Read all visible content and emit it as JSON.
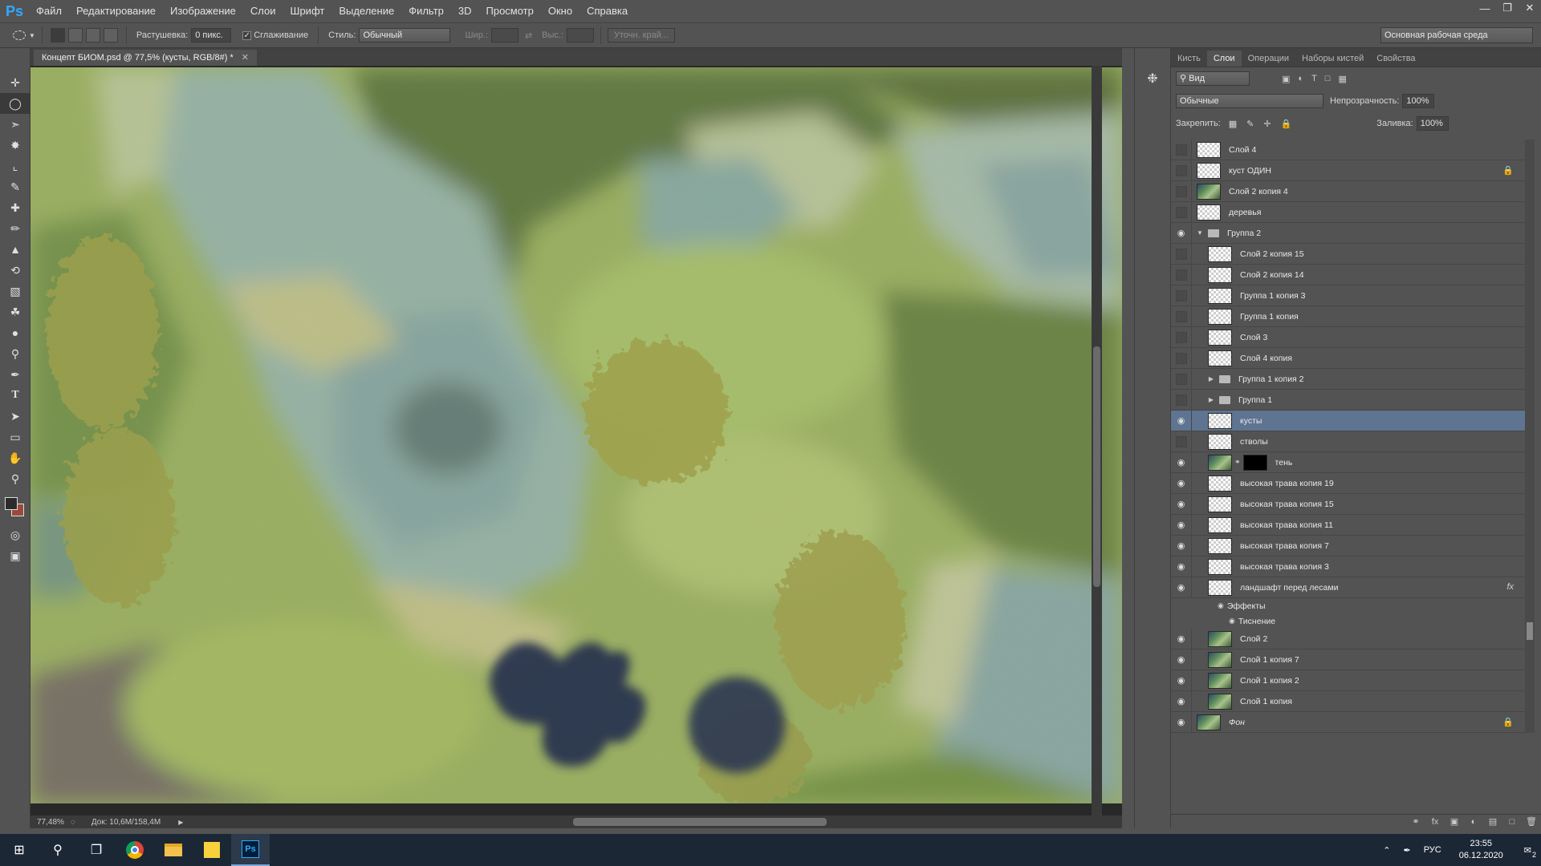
{
  "app": {
    "logo": "Ps",
    "menu": [
      "Файл",
      "Редактирование",
      "Изображение",
      "Слои",
      "Шрифт",
      "Выделение",
      "Фильтр",
      "3D",
      "Просмотр",
      "Окно",
      "Справка"
    ]
  },
  "options": {
    "feather_label": "Растушевка:",
    "feather_value": "0 пикс.",
    "antialias_label": "Сглаживание",
    "style_label": "Стиль:",
    "style_value": "Обычный",
    "width_label": "Шир.:",
    "height_label": "Выс.:",
    "refine_edge": "Уточн. край...",
    "workspace": "Основная рабочая среда"
  },
  "document": {
    "tab_title": "Концепт БИОМ.psd @ 77,5% (кусты, RGB/8#) *",
    "zoom": "77,48%",
    "doc_size": "Док: 10,6M/158,4M"
  },
  "panel": {
    "tabs": [
      "Кисть",
      "Слои",
      "Операции",
      "Наборы кистей",
      "Свойства"
    ],
    "filter_label": "Вид",
    "blend_mode": "Обычные",
    "opacity_label": "Непрозрачность:",
    "opacity_value": "100%",
    "lock_label": "Закрепить:",
    "fill_label": "Заливка:",
    "fill_value": "100%"
  },
  "layers": [
    {
      "name": "Слой 4",
      "visible": false,
      "thumb": "transparent",
      "indent": 0
    },
    {
      "name": "куст ОДИН",
      "visible": false,
      "thumb": "transparent",
      "indent": 0,
      "locked": true
    },
    {
      "name": "Слой 2 копия 4",
      "visible": false,
      "thumb": "image",
      "indent": 0
    },
    {
      "name": "деревья",
      "visible": false,
      "thumb": "transparent",
      "indent": 0
    },
    {
      "name": "Группа 2",
      "visible": true,
      "group": true,
      "expanded": true,
      "indent": 0
    },
    {
      "name": "Слой 2 копия 15",
      "visible": false,
      "thumb": "transparent",
      "indent": 1
    },
    {
      "name": "Слой 2 копия 14",
      "visible": false,
      "thumb": "transparent",
      "indent": 1
    },
    {
      "name": "Группа 1 копия 3",
      "visible": false,
      "thumb": "transparent",
      "indent": 1
    },
    {
      "name": "Группа 1 копия",
      "visible": false,
      "thumb": "transparent",
      "indent": 1
    },
    {
      "name": "Слой 3",
      "visible": false,
      "thumb": "transparent",
      "indent": 1
    },
    {
      "name": "Слой 4 копия",
      "visible": false,
      "thumb": "transparent",
      "indent": 1
    },
    {
      "name": "Группа 1 копия 2",
      "visible": false,
      "group": true,
      "expanded": false,
      "indent": 1
    },
    {
      "name": "Группа 1",
      "visible": false,
      "group": true,
      "expanded": false,
      "indent": 1
    },
    {
      "name": "кусты",
      "visible": true,
      "thumb": "transparent",
      "indent": 1,
      "selected": true
    },
    {
      "name": "стволы",
      "visible": false,
      "thumb": "transparent",
      "indent": 1
    },
    {
      "name": "тень",
      "visible": true,
      "thumb": "image",
      "mask": true,
      "indent": 1
    },
    {
      "name": "высокая трава копия 19",
      "visible": true,
      "thumb": "transparent",
      "indent": 1
    },
    {
      "name": "высокая трава копия 15",
      "visible": true,
      "thumb": "transparent",
      "indent": 1
    },
    {
      "name": "высокая трава копия 11",
      "visible": true,
      "thumb": "transparent",
      "indent": 1
    },
    {
      "name": "высокая трава копия 7",
      "visible": true,
      "thumb": "transparent",
      "indent": 1
    },
    {
      "name": "высокая трава копия 3",
      "visible": true,
      "thumb": "transparent",
      "indent": 1
    },
    {
      "name": "ландшафт перед лесами",
      "visible": true,
      "thumb": "transparent",
      "indent": 1,
      "fx": true
    },
    {
      "name": "Эффекты",
      "effect": true,
      "indent": 2
    },
    {
      "name": "Тиснение",
      "effect": true,
      "indent": 3
    },
    {
      "name": "Слой 2",
      "visible": true,
      "thumb": "image",
      "indent": 1
    },
    {
      "name": "Слой 1 копия 7",
      "visible": true,
      "thumb": "image",
      "indent": 1
    },
    {
      "name": "Слой 1 копия 2",
      "visible": true,
      "thumb": "image",
      "indent": 1
    },
    {
      "name": "Слой 1 копия",
      "visible": true,
      "thumb": "image",
      "indent": 1
    },
    {
      "name": "Фон",
      "visible": true,
      "thumb": "image",
      "indent": 0,
      "locked": true,
      "italic": true
    }
  ],
  "taskbar": {
    "language": "РУС",
    "time": "23:55",
    "date": "06.12.2020",
    "notifications": "2"
  },
  "colors": {
    "accent": "#31a8ff",
    "selected_layer": "#5e7491"
  }
}
